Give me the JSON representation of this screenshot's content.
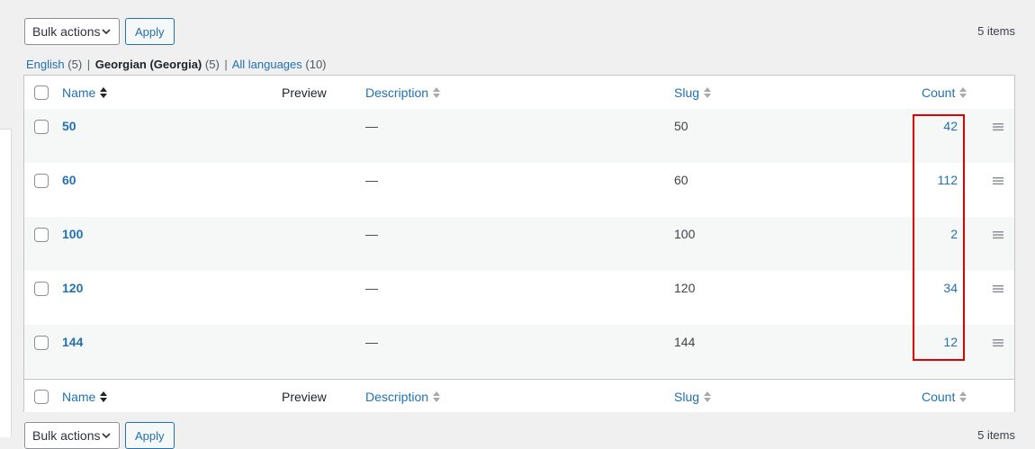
{
  "top_nav": {
    "bulk_actions": "Bulk actions",
    "apply": "Apply",
    "items_count": "5 items"
  },
  "bottom_nav": {
    "bulk_actions": "Bulk actions",
    "apply": "Apply",
    "items_count": "5 items"
  },
  "language_filter": [
    {
      "label": "English",
      "count": "(5)"
    },
    {
      "label": "Georgian (Georgia)",
      "count": "(5)"
    },
    {
      "label": "All languages",
      "count": "(10)"
    }
  ],
  "columns": {
    "name": "Name",
    "preview": "Preview",
    "description": "Description",
    "slug": "Slug",
    "count": "Count"
  },
  "rows": [
    {
      "name": "50",
      "description": "—",
      "slug": "50",
      "count": "42"
    },
    {
      "name": "60",
      "description": "—",
      "slug": "60",
      "count": "112"
    },
    {
      "name": "100",
      "description": "—",
      "slug": "100",
      "count": "2"
    },
    {
      "name": "120",
      "description": "—",
      "slug": "120",
      "count": "34"
    },
    {
      "name": "144",
      "description": "—",
      "slug": "144",
      "count": "12"
    }
  ],
  "colors": {
    "link": "#2271b1",
    "highlight": "#e10000",
    "alt_row": "#f6f7f7"
  },
  "icons": {
    "sort": "sort-arrows-icon",
    "drag": "drag-handle-icon",
    "dropdown": "chevron-down-icon"
  }
}
